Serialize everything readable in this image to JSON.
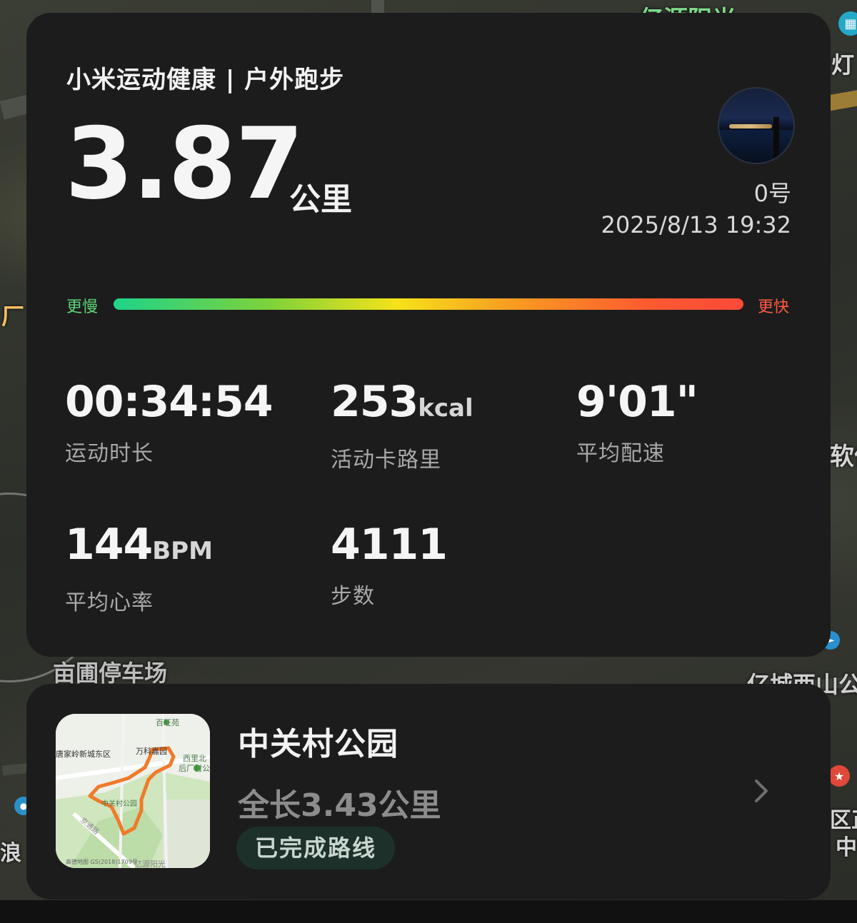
{
  "header": {
    "title": "小米运动健康 | 户外跑步"
  },
  "activity": {
    "distance": "3.87",
    "distance_unit": "公里",
    "user_name": "0号",
    "date_time": "2025/8/13 19:32"
  },
  "pace_scale": {
    "slow_label": "更慢",
    "fast_label": "更快",
    "colors": [
      "#1fd38a",
      "#7fd23a",
      "#f5e21a",
      "#f9a020",
      "#ff5a30",
      "#ff4a3a"
    ]
  },
  "stats": {
    "duration": {
      "value": "00:34:54",
      "unit": "",
      "label": "运动时长"
    },
    "calories": {
      "value": "253",
      "unit": "kcal",
      "label": "活动卡路里"
    },
    "pace": {
      "value": "9'01\"",
      "unit": "",
      "label": "平均配速"
    },
    "heart_rate": {
      "value": "144",
      "unit": "BPM",
      "label": "平均心率"
    },
    "steps": {
      "value": "4111",
      "unit": "",
      "label": "步数"
    }
  },
  "route": {
    "name": "中关村公园",
    "length": "全长3.43公里",
    "status": "已完成路线",
    "thumbnail_labels": {
      "baiwangyuan": "百旺苑",
      "tangjialing": "唐家岭新城东区",
      "wanyuan": "万科嘉园",
      "xili": "西里北",
      "houchang": "后厂村公",
      "park": "中关村公园",
      "road": "京通路",
      "copyright": "高德地图 GS(2018)1709号",
      "yiyuan": "亿源阳光"
    }
  },
  "map_labels": {
    "top": "亿源阳光",
    "right_top": "灯",
    "left_mid": "厂",
    "right_mid": "软件",
    "parking": "亩圃停车场",
    "right_lower": "亿城西山公",
    "right_bottom1": "区正",
    "right_bottom2": "中",
    "left_bottom": "浪"
  },
  "colors": {
    "card_bg": "#1c1c1c",
    "accent_slow": "#5fd27a",
    "accent_fast": "#ff5a42",
    "route_line": "#f07a2a",
    "badge_bg": "#1d302a"
  }
}
